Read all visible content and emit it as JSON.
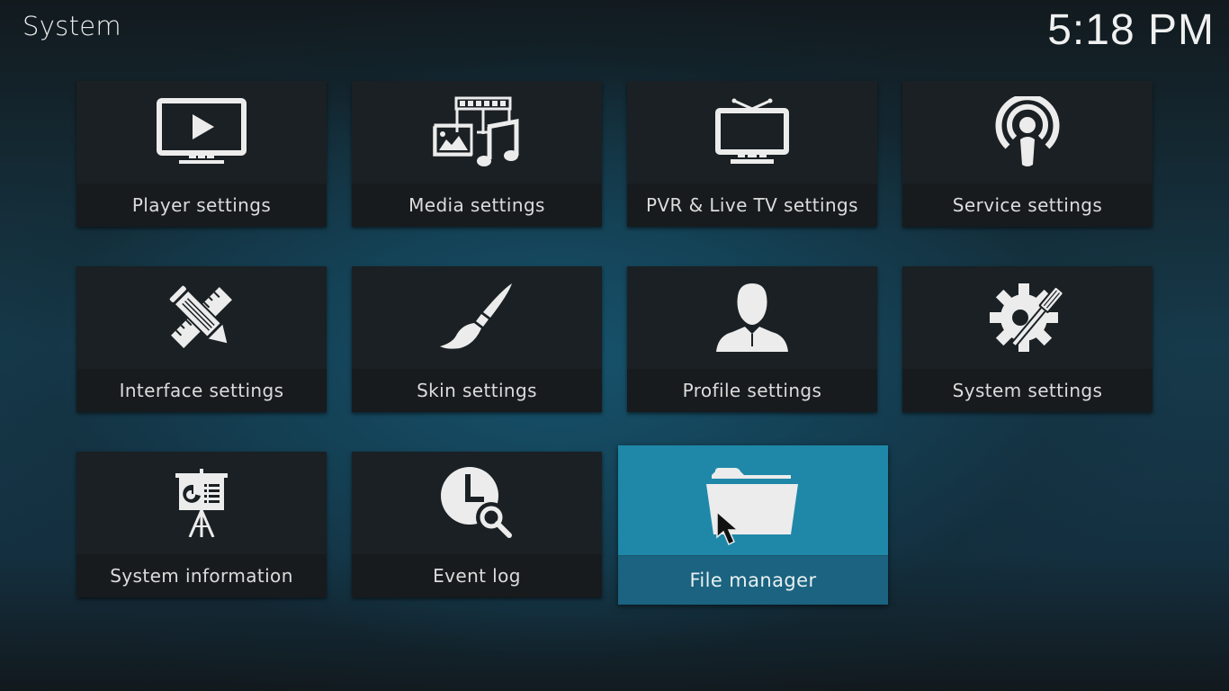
{
  "header": {
    "title": "System",
    "clock": "5:18 PM"
  },
  "tiles": [
    {
      "label": "Player settings",
      "icon": "monitor-play-icon"
    },
    {
      "label": "Media settings",
      "icon": "media-icon"
    },
    {
      "label": "PVR & Live TV settings",
      "icon": "tv-antenna-icon"
    },
    {
      "label": "Service settings",
      "icon": "broadcast-icon"
    },
    {
      "label": "Interface settings",
      "icon": "pencil-ruler-icon"
    },
    {
      "label": "Skin settings",
      "icon": "paintbrush-icon"
    },
    {
      "label": "Profile settings",
      "icon": "user-icon"
    },
    {
      "label": "System settings",
      "icon": "gear-screwdriver-icon"
    },
    {
      "label": "System information",
      "icon": "presentation-board-icon"
    },
    {
      "label": "Event log",
      "icon": "clock-search-icon"
    },
    {
      "label": "File manager",
      "icon": "folder-icon",
      "focused": true
    }
  ],
  "colors": {
    "focus": "#1f88a8",
    "focus_label": "#1b6380",
    "tile": "#1a2023",
    "tile_label": "#171b1d"
  }
}
